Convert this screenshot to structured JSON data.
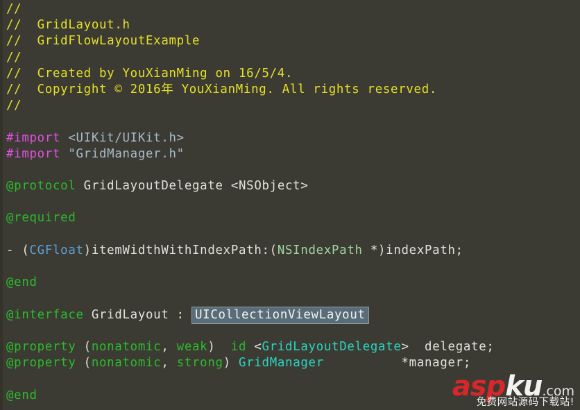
{
  "editor": {
    "language": "Objective-C",
    "filename": "GridLayout.h",
    "background_color": "#3b3b33",
    "gutter_color": "#333329",
    "colors": {
      "comment": "#e6e028",
      "preprocessor": "#e24fe2",
      "header_path": "#a9bac9",
      "keyword": "#2cba2c",
      "plain_text": "#e2e2dc",
      "primitive_type": "#5ca0d6",
      "class_pale": "#9fd5a0",
      "protocol_type": "#2bd4c2",
      "selection_fill": "#5b6c79",
      "selection_border": "#8d9ca6"
    },
    "lines": [
      {
        "id": "l01",
        "tokens": [
          {
            "t": "//",
            "c": "comment"
          }
        ]
      },
      {
        "id": "l02",
        "tokens": [
          {
            "t": "//  GridLayout.h",
            "c": "comment"
          }
        ]
      },
      {
        "id": "l03",
        "tokens": [
          {
            "t": "//  GridFlowLayoutExample",
            "c": "comment"
          }
        ]
      },
      {
        "id": "l04",
        "tokens": [
          {
            "t": "//",
            "c": "comment"
          }
        ]
      },
      {
        "id": "l05",
        "tokens": [
          {
            "t": "//  Created by YouXianMing on 16/5/4.",
            "c": "comment"
          }
        ]
      },
      {
        "id": "l06",
        "tokens": [
          {
            "t": "//  Copyright © 2016年 YouXianMing. All rights reserved.",
            "c": "comment"
          }
        ]
      },
      {
        "id": "l07",
        "tokens": [
          {
            "t": "//",
            "c": "comment"
          }
        ]
      },
      {
        "id": "l08",
        "blank": true,
        "tokens": []
      },
      {
        "id": "l09",
        "tokens": [
          {
            "t": "#import",
            "c": "preprocessor"
          },
          {
            "t": " ",
            "c": "plain"
          },
          {
            "t": "<UIKit/UIKit.h>",
            "c": "header"
          }
        ]
      },
      {
        "id": "l10",
        "tokens": [
          {
            "t": "#import",
            "c": "preprocessor"
          },
          {
            "t": " ",
            "c": "plain"
          },
          {
            "t": "\"GridManager.h\"",
            "c": "header"
          }
        ]
      },
      {
        "id": "l11",
        "blank": true,
        "tokens": []
      },
      {
        "id": "l12",
        "tokens": [
          {
            "t": "@protocol",
            "c": "keyword"
          },
          {
            "t": " GridLayoutDelegate <NSObject>",
            "c": "plain"
          }
        ]
      },
      {
        "id": "l13",
        "blank": true,
        "tokens": []
      },
      {
        "id": "l14",
        "tokens": [
          {
            "t": "@required",
            "c": "keyword"
          }
        ]
      },
      {
        "id": "l15",
        "blank": true,
        "tokens": []
      },
      {
        "id": "l16",
        "tokens": [
          {
            "t": "- (",
            "c": "plain"
          },
          {
            "t": "CGFloat",
            "c": "primtype"
          },
          {
            "t": ")itemWidthWithIndexPath:(",
            "c": "plain"
          },
          {
            "t": "NSIndexPath",
            "c": "classpale"
          },
          {
            "t": " *)indexPath;",
            "c": "plain"
          }
        ]
      },
      {
        "id": "l17",
        "blank": true,
        "tokens": []
      },
      {
        "id": "l18",
        "tokens": [
          {
            "t": "@end",
            "c": "keyword"
          }
        ]
      },
      {
        "id": "l19",
        "blank": true,
        "tokens": []
      },
      {
        "id": "l20",
        "tokens": [
          {
            "t": "@interface",
            "c": "keyword"
          },
          {
            "t": " GridLayout : ",
            "c": "plain"
          },
          {
            "t": "UICollectionViewLayout",
            "c": "selected"
          }
        ]
      },
      {
        "id": "l21",
        "blank": true,
        "tokens": []
      },
      {
        "id": "l22",
        "tokens": [
          {
            "t": "@property",
            "c": "keyword"
          },
          {
            "t": " (",
            "c": "plain"
          },
          {
            "t": "nonatomic",
            "c": "keyword"
          },
          {
            "t": ", ",
            "c": "plain"
          },
          {
            "t": "weak",
            "c": "keyword"
          },
          {
            "t": ")  ",
            "c": "plain"
          },
          {
            "t": "id",
            "c": "keyword"
          },
          {
            "t": " <",
            "c": "plain"
          },
          {
            "t": "GridLayoutDelegate",
            "c": "proto"
          },
          {
            "t": ">  delegate;",
            "c": "plain"
          }
        ]
      },
      {
        "id": "l23",
        "tokens": [
          {
            "t": "@property",
            "c": "keyword"
          },
          {
            "t": " (",
            "c": "plain"
          },
          {
            "t": "nonatomic",
            "c": "keyword"
          },
          {
            "t": ", ",
            "c": "plain"
          },
          {
            "t": "strong",
            "c": "keyword"
          },
          {
            "t": ") ",
            "c": "plain"
          },
          {
            "t": "GridManager",
            "c": "proto"
          },
          {
            "t": "          *manager;",
            "c": "plain"
          }
        ]
      },
      {
        "id": "l24",
        "blank": true,
        "tokens": []
      },
      {
        "id": "l25",
        "tokens": [
          {
            "t": "@end",
            "c": "keyword"
          }
        ]
      }
    ]
  },
  "watermark": {
    "brand_asp": "asp",
    "brand_ku": "ku",
    "brand_tld": ".com",
    "tagline": "免费网站源码下载站!",
    "asp_color": "#d8262a",
    "ku_color": "#f2f2f2"
  }
}
